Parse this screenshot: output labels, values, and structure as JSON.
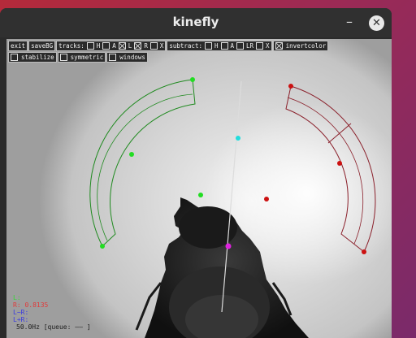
{
  "window": {
    "title": "kinefly",
    "minimize_glyph": "–",
    "close_glyph": "✕"
  },
  "toolbar": {
    "row1": {
      "exit_label": "exit",
      "save_label": "saveBG",
      "tracks": {
        "label": "tracks:",
        "options": [
          {
            "label": "H",
            "checked": false
          },
          {
            "label": "A",
            "checked": false
          },
          {
            "label": "L",
            "checked": true
          },
          {
            "label": "R",
            "checked": true
          },
          {
            "label": "X",
            "checked": false
          }
        ]
      },
      "subtract": {
        "label": "subtract:",
        "options": [
          {
            "label": "H",
            "checked": false
          },
          {
            "label": "A",
            "checked": false
          },
          {
            "label": "LR",
            "checked": false
          },
          {
            "label": "X",
            "checked": false
          }
        ]
      },
      "invertcolor": {
        "label": "invertcolor",
        "checked": true
      }
    },
    "row2": {
      "stabilize": {
        "label": "stabilize",
        "checked": false
      },
      "symmetric": {
        "label": "symmetric",
        "checked": false
      },
      "windows": {
        "label": "windows",
        "checked": false
      }
    }
  },
  "readouts": {
    "left": {
      "text": "L:",
      "color": "#39d639"
    },
    "right": {
      "text": "R: 0.8135",
      "color": "#e03a3a"
    },
    "l_minus_r": {
      "text": "L−R:",
      "color": "#3a3ae0"
    },
    "l_plus_r": {
      "text": "L+R:",
      "color": "#3a3ae0"
    },
    "rate": {
      "text": "50.0Hz [queue: ——      ]",
      "color": "#202020"
    }
  },
  "colors": {
    "left_wing": "#1f8a1f",
    "left_point": "#22dd22",
    "right_wing": "#8a1f2a",
    "right_point": "#cc1111",
    "axis_point": "#22dddd",
    "center_point": "#dd22dd"
  }
}
